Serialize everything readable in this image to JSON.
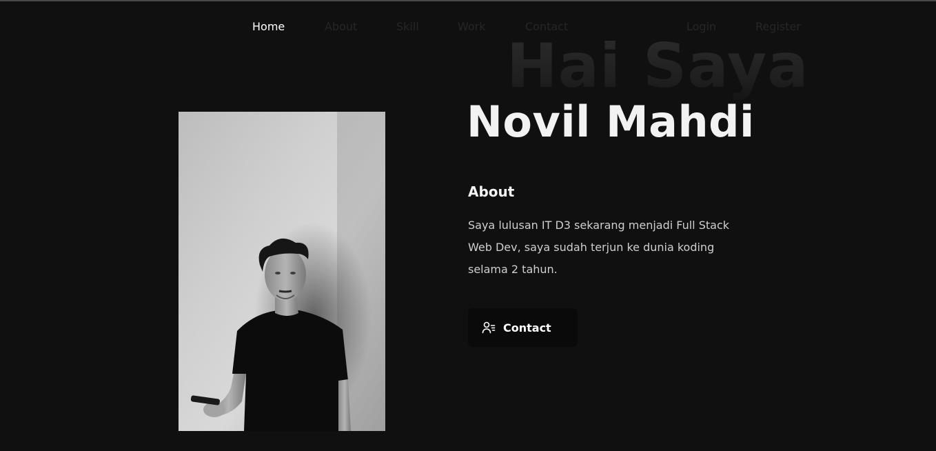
{
  "nav": {
    "home": "Home",
    "about": "About",
    "skill": "Skill",
    "work": "Work",
    "contact": "Contact",
    "login": "Login",
    "register": "Register",
    "active": "Home"
  },
  "hero": {
    "watermark": "Hai Saya",
    "name": "Novil Mahdi"
  },
  "about": {
    "heading": "About",
    "text": "Saya lulusan IT D3 sekarang menjadi Full Stack Web Dev, saya sudah terjun ke dunia koding selama 2 tahun."
  },
  "cta": {
    "label": "Contact",
    "icon": "user-list-icon"
  },
  "colors": {
    "background": "#101010",
    "text": "#ffffff",
    "muted_nav": "#262626",
    "button_bg": "#0a0a0a"
  }
}
